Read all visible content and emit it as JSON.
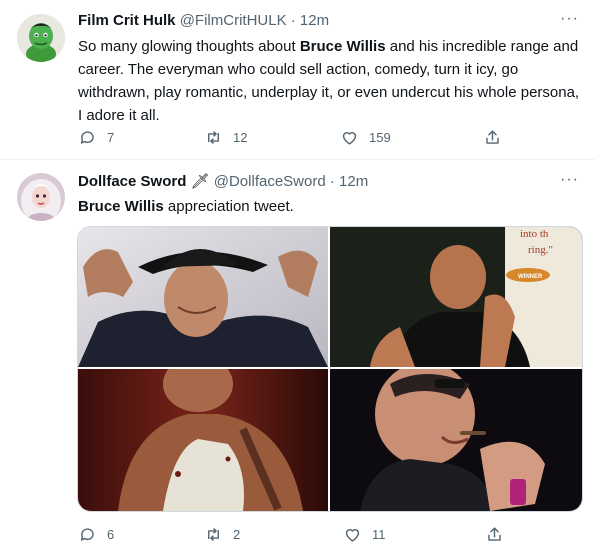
{
  "tweets": [
    {
      "display_name": "Film Crit Hulk",
      "handle": "@FilmCritHULK",
      "separator": "·",
      "time": "12m",
      "text_parts": [
        "So many glowing thoughts about ",
        "Bruce Willis",
        " and his incredible range and career. The everyman who could sell action, comedy, turn it icy, go withdrawn, play romantic, underplay it, or even undercut his whole persona, I adore it all."
      ],
      "more_label": "···",
      "replies": "7",
      "retweets": "12",
      "likes": "159"
    },
    {
      "display_name": "Dollface Sword",
      "name_emoji": "🗡",
      "handle": "@DollfaceSword",
      "separator": "·",
      "time": "12m",
      "text_parts": [
        "Bruce Willis",
        " appreciation tweet."
      ],
      "more_label": "···",
      "replies": "6",
      "retweets": "2",
      "likes": "11",
      "photo_overlay_text": [
        "into th",
        "ring.\""
      ]
    }
  ],
  "icons": [
    "reply-icon",
    "retweet-icon",
    "like-icon",
    "share-icon",
    "more-icon"
  ],
  "colors": {
    "text": "#0f1419",
    "secondary": "#536471",
    "border": "#eff3f4",
    "avatar_hulk_bg": "#e9e8e0",
    "hulk_green": "#4caf50"
  }
}
